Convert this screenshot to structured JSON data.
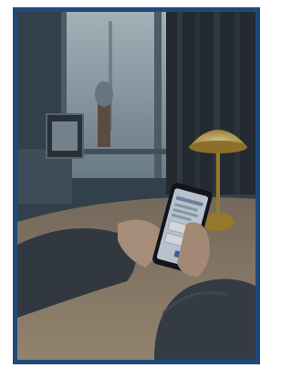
{
  "photo": {
    "subject": "photo-scene",
    "frame_color": "#1e4a7a",
    "palette": {
      "wall": "#3f4d5a",
      "window": "#9fb2bd",
      "curtain": "#2b2f33",
      "table": "#a58f73",
      "sweater": "#3a3f45",
      "lamp": "#c9a43a",
      "phone_screen": "#dfe6ef"
    }
  }
}
